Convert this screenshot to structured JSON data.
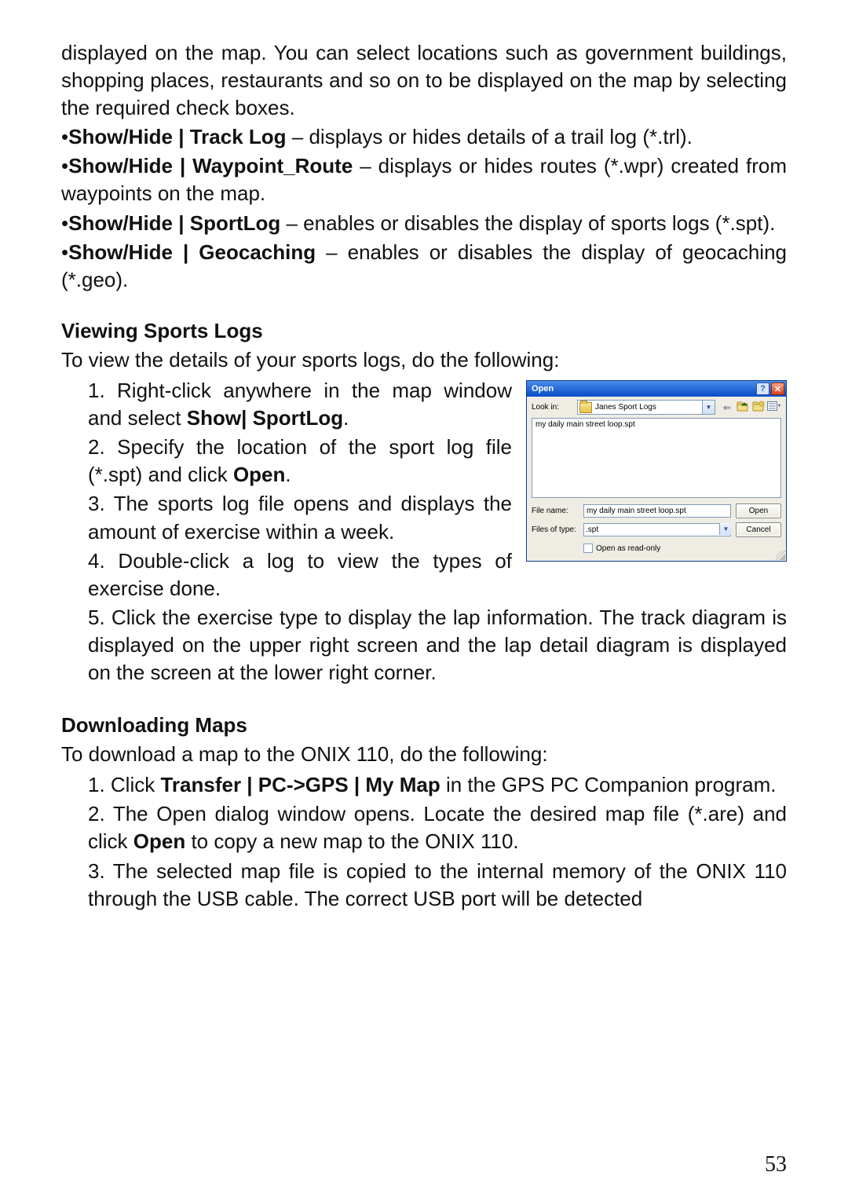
{
  "prelude": {
    "p1": "displayed on the map. You can select locations such as government buildings, shopping places, restaurants and so on to be displayed on the map by selecting the required check boxes.",
    "items": [
      {
        "label": "Show/Hide | Track Log",
        "tail": " – displays or hides details of a trail log (*.trl)."
      },
      {
        "label": "Show/Hide | Waypoint_Route",
        "tail": " – displays or hides routes (*.wpr) created from waypoints on the map."
      },
      {
        "label": "Show/Hide | SportLog",
        "tail": " – enables or disables the display of sports logs (*.spt)."
      },
      {
        "label": "Show/Hide | Geocaching",
        "tail": " – enables or disables the display of geocaching (*.geo)."
      }
    ]
  },
  "section_sports": {
    "heading": "Viewing Sports Logs",
    "intro": "To view the details of your sports logs, do the following:",
    "steps": {
      "s1_pre": "1. Right-click anywhere in the map window and select ",
      "s1_bold": "Show| SportLog",
      "s1_post": ".",
      "s2_pre": "2. Specify the location of the sport log file (*.spt) and click ",
      "s2_bold": "Open",
      "s2_post": ".",
      "s3": "3. The sports log file opens and displays the amount of exercise within a week.",
      "s4": "4. Double-click a log to view the types of exercise done.",
      "s5": "5. Click the exercise type to display the lap information. The track diagram is displayed on the upper right screen and the lap detail diagram is displayed on the screen at the lower right corner."
    }
  },
  "section_download": {
    "heading": "Downloading Maps",
    "intro": "To download a map to the ONIX 110, do the following:",
    "steps": {
      "s1_pre": "1. Click ",
      "s1_bold": "Transfer | PC->GPS | My Map",
      "s1_post": " in the GPS PC Companion program.",
      "s2_pre": "2. The Open dialog window opens. Locate the desired map file (*.are) and click ",
      "s2_bold": "Open",
      "s2_post": " to copy a new map to the ONIX 110.",
      "s3": "3. The selected map file is copied to the internal memory of the ONIX 110 through the USB cable. The correct USB port will be detected"
    }
  },
  "dialog": {
    "title": "Open",
    "help_glyph": "?",
    "close_glyph": "✕",
    "look_in_label": "Look in:",
    "look_in_folder": "Janes Sport Logs",
    "toolbar": {
      "back": "⇐",
      "up": "folder-up",
      "new_folder": "new-folder",
      "views": "views"
    },
    "file_list_item": "my daily main street loop.spt",
    "file_name_label": "File name:",
    "file_name_value": "my daily main street loop.spt",
    "files_of_type_label": "Files of type:",
    "files_of_type_value": ".spt",
    "open_btn": "Open",
    "cancel_btn": "Cancel",
    "readonly_label": "Open as read-only"
  },
  "page_number": "53"
}
